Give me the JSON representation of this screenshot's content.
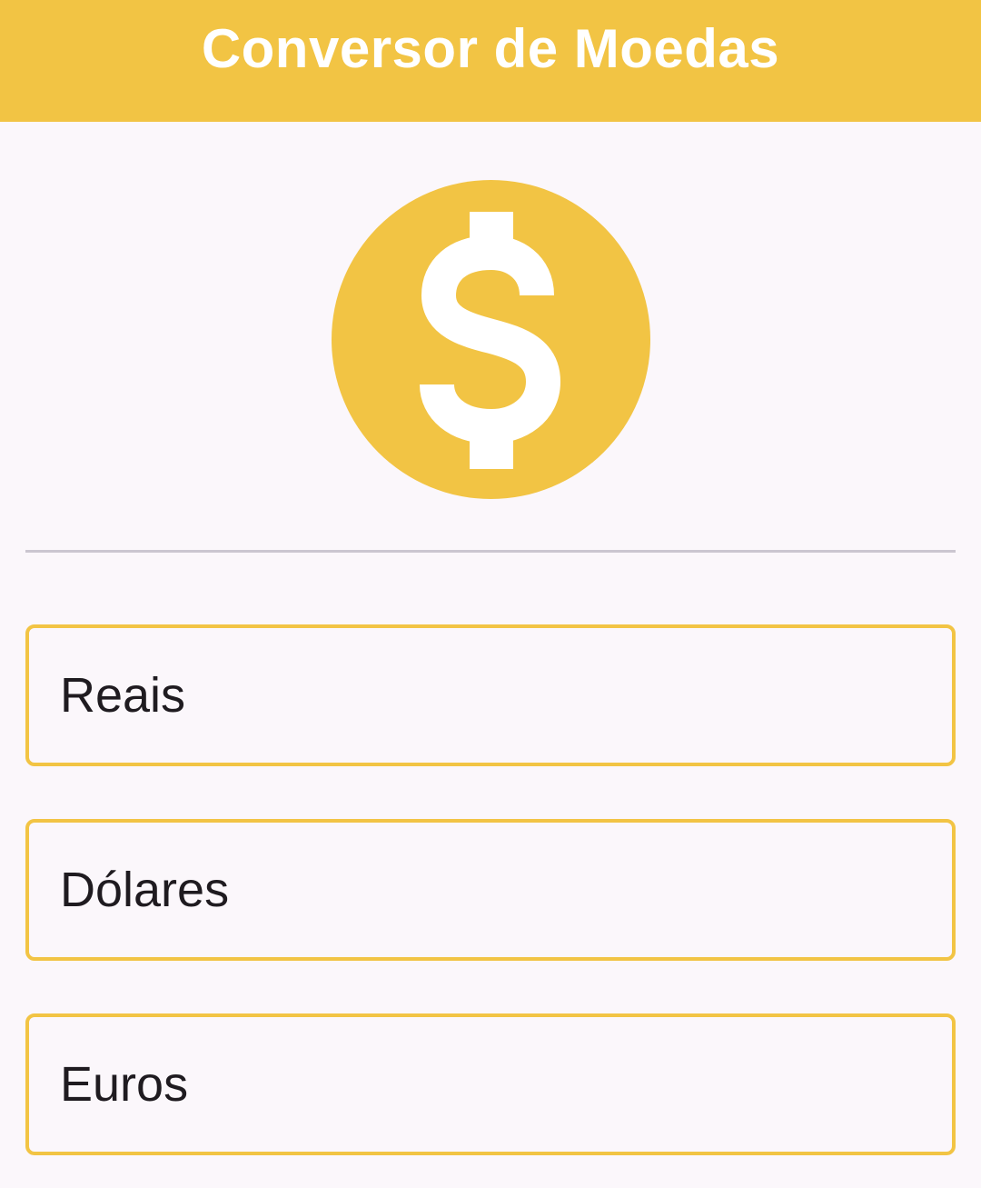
{
  "app_bar": {
    "title": "Conversor de Moedas",
    "background_color": "#f2c444",
    "title_color": "#ffffff"
  },
  "hero": {
    "icon": "dollar-coin-icon",
    "icon_color": "#f2c444"
  },
  "fields": [
    {
      "placeholder": "Reais",
      "value": ""
    },
    {
      "placeholder": "Dólares",
      "value": ""
    },
    {
      "placeholder": "Euros",
      "value": ""
    }
  ],
  "colors": {
    "accent": "#f2c444",
    "background": "#fbf7fb",
    "divider": "#cbc6d0",
    "text": "#1f1b20"
  }
}
